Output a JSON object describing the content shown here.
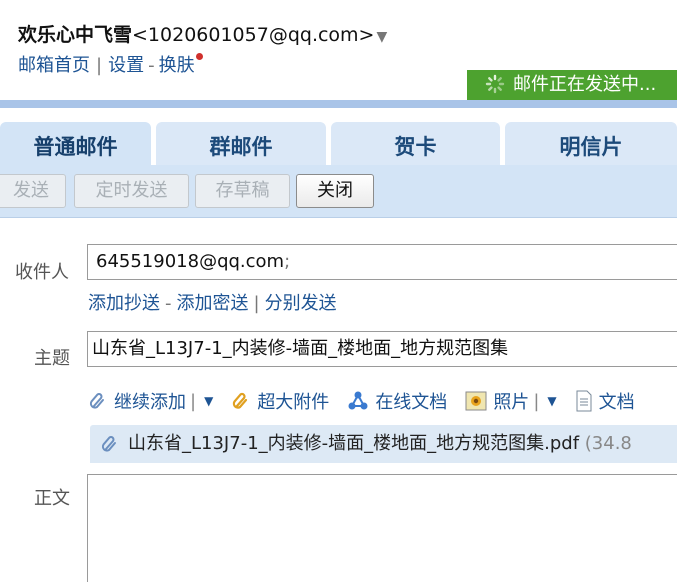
{
  "header": {
    "user_name": "欢乐心中飞雪",
    "user_email": "<1020601057@qq.com>",
    "caret": "▼",
    "link_home": "邮箱首页",
    "link_settings": "设置",
    "link_skin": "换肤",
    "sending_status": "邮件正在发送中..."
  },
  "tabs": [
    {
      "label": "普通邮件",
      "active": true
    },
    {
      "label": "群邮件",
      "active": false
    },
    {
      "label": "贺卡",
      "active": false
    },
    {
      "label": "明信片",
      "active": false
    }
  ],
  "toolbar": {
    "send": "发送",
    "scheduled_send": "定时发送",
    "save_draft": "存草稿",
    "close": "关闭"
  },
  "form": {
    "recipient_label": "收件人",
    "recipient_value": "645519018@qq.com",
    "recipient_sep": ";",
    "add_cc": "添加抄送",
    "add_bcc": "添加密送",
    "separate_send": "分别发送",
    "subject_label": "主题",
    "subject_value": "山东省_L13J7-1_内装修-墙面_楼地面_地方规范图集",
    "body_label": "正文"
  },
  "attachments": {
    "continue_add": "继续添加",
    "large_attachment": "超大附件",
    "online_doc": "在线文档",
    "photo": "照片",
    "document": "文档",
    "file_name": "山东省_L13J7-1_内装修-墙面_楼地面_地方规范图集.pdf",
    "file_size": "(34.8"
  },
  "colors": {
    "sending_green": "#4da22f",
    "tab_bg": "#dbe8f7",
    "link_blue": "#1e5494"
  }
}
